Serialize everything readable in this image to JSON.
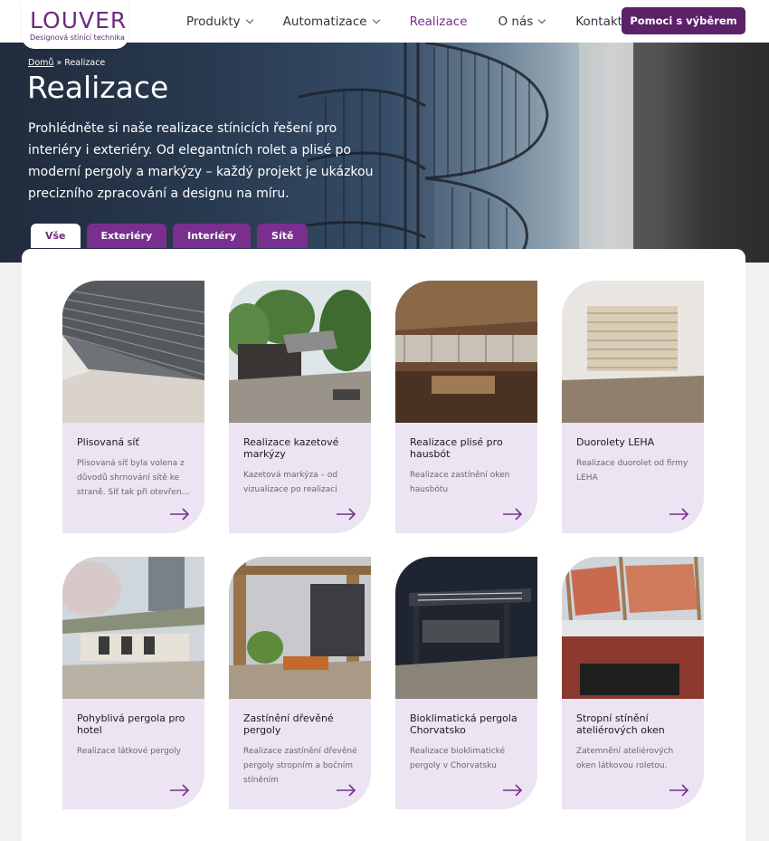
{
  "logo": {
    "word": "LOUVER",
    "tagline": "Designová stínící technika"
  },
  "nav": {
    "items": [
      {
        "label": "Produkty",
        "has_dropdown": true
      },
      {
        "label": "Automatizace",
        "has_dropdown": true
      },
      {
        "label": "Realizace",
        "has_dropdown": false,
        "active": true
      },
      {
        "label": "O nás",
        "has_dropdown": true
      },
      {
        "label": "Kontakt",
        "has_dropdown": false
      }
    ],
    "cta_label": "Pomoci s výběrem"
  },
  "hero": {
    "breadcrumb": {
      "home": "Domů",
      "separator": "»",
      "current": "Realizace"
    },
    "title": "Realizace",
    "description": "Prohlédněte si naše realizace stínicích řešení pro interiéry i exteriéry. Od elegantních rolet a plisé po moderní pergoly a markýzy – každý projekt je ukázkou precizního zpracování a designu na míru."
  },
  "tabs": [
    {
      "label": "Vše",
      "active": true
    },
    {
      "label": "Exteriéry",
      "active": false
    },
    {
      "label": "Interiéry",
      "active": false
    },
    {
      "label": "Sítě",
      "active": false
    }
  ],
  "cards": [
    {
      "title": "Plisovaná síť",
      "description": "Plisovaná síť byla volena z důvodů shrnování sítě ke straně. Síť tak při otevřen…"
    },
    {
      "title": "Realizace kazetové markýzy",
      "description": "Kazetová markýza – od vizualizace po realizaci"
    },
    {
      "title": "Realizace plisé pro hausbót",
      "description": "Realizace zastínění oken hausbótu"
    },
    {
      "title": "Duorolety LEHA",
      "description": "Realizace duorolet od firmy LEHA"
    },
    {
      "title": "Pohyblivá pergola pro hotel",
      "description": "Realizace látkové pergoly"
    },
    {
      "title": "Zastínění dřevěné pergoly",
      "description": "Realizace zastínění dřevěné pergoly stropním a bočním stíněním"
    },
    {
      "title": "Bioklimatická pergola Chorvatsko",
      "description": "Realizace bioklimatické pergoly v Chorvatsku"
    },
    {
      "title": "Stropní stínění ateliérových oken",
      "description": "Zatemnění ateliérových oken látkovou roletou."
    }
  ],
  "colors": {
    "brand": "#6e2b80",
    "cta": "#5b2169",
    "tab": "#7a2e8e",
    "card_bg": "#ece4f2"
  }
}
